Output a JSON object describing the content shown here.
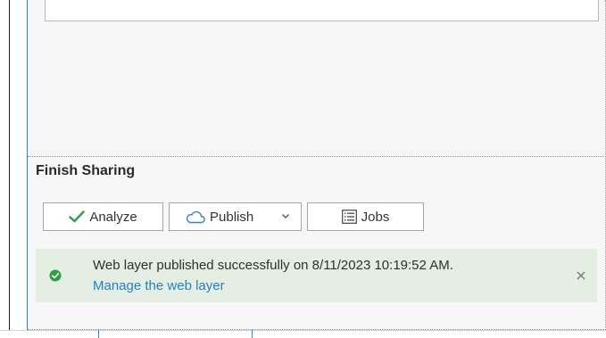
{
  "finish_sharing": {
    "title": "Finish Sharing",
    "buttons": {
      "analyze": {
        "label": "Analyze",
        "icon": "checkmark-icon"
      },
      "publish": {
        "label": "Publish",
        "icon": "cloud-icon",
        "dropdown_icon": "chevron-down-icon"
      },
      "jobs": {
        "label": "Jobs",
        "icon": "list-icon"
      }
    },
    "message": {
      "text": "Web layer published successfully on 8/11/2023 10:19:52 AM.",
      "link": "Manage the web layer",
      "status_icon": "success-check-icon",
      "close_icon": "close-icon"
    }
  },
  "colors": {
    "accent": "#2d84c8",
    "success": "#2e9e47",
    "link": "#1f82c4",
    "message_background": "#e5eee3"
  }
}
